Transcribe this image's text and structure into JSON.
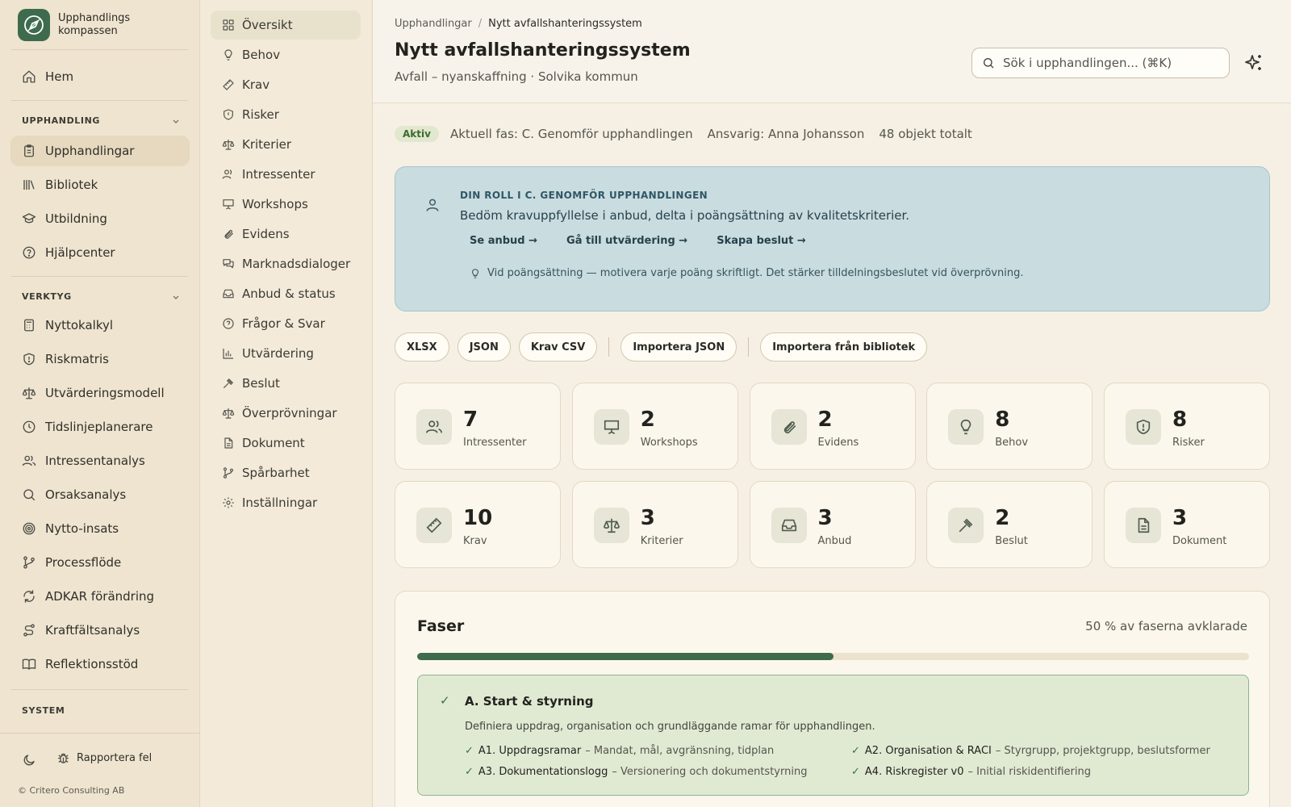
{
  "brand": {
    "name": "Upphandlings kompassen"
  },
  "sidebar": {
    "home": "Hem",
    "sections": {
      "procurement": "UPPHANDLING",
      "tools": "VERKTYG",
      "system": "SYSTEM"
    },
    "procurement_items": [
      "Upphandlingar",
      "Bibliotek",
      "Utbildning",
      "Hjälpcenter"
    ],
    "tool_items": [
      "Nyttokalkyl",
      "Riskmatris",
      "Utvärderingsmodell",
      "Tidslinjeplanerare",
      "Intressentanalys",
      "Orsaksanalys",
      "Nytto-insats",
      "Processflöde",
      "ADKAR förändring",
      "Kraftfältsanalys",
      "Reflektionsstöd"
    ],
    "report_bug": "Rapportera fel",
    "copyright": "© Critero Consulting AB"
  },
  "subnav": {
    "items": [
      "Översikt",
      "Behov",
      "Krav",
      "Risker",
      "Kriterier",
      "Intressenter",
      "Workshops",
      "Evidens",
      "Marknadsdialoger",
      "Anbud & status",
      "Frågor & Svar",
      "Utvärdering",
      "Beslut",
      "Överprövningar",
      "Dokument",
      "Spårbarhet",
      "Inställningar"
    ]
  },
  "header": {
    "breadcrumb_root": "Upphandlingar",
    "breadcrumb_current": "Nytt avfallshanteringssystem",
    "title": "Nytt avfallshanteringssystem",
    "subtitle": "Avfall – nyanskaffning · Solvika kommun",
    "search_placeholder": "Sök i upphandlingen... (⌘K)"
  },
  "status": {
    "badge": "Aktiv",
    "phase": "Aktuell fas: C. Genomför upphandlingen",
    "owner": "Ansvarig: Anna Johansson",
    "total": "48 objekt totalt"
  },
  "role": {
    "eyebrow": "DIN ROLL I C. GENOMFÖR UPPHANDLINGEN",
    "text": "Bedöm kravuppfyllelse i anbud, delta i poängsättning av kvalitetskriterier.",
    "links": [
      "Se anbud →",
      "Gå till utvärdering →",
      "Skapa beslut →"
    ],
    "tip": "Vid poängsättning — motivera varje poäng skriftligt. Det stärker tilldelningsbeslutet vid överprövning."
  },
  "actions": {
    "export": [
      "XLSX",
      "JSON",
      "Krav CSV"
    ],
    "import_json": "Importera JSON",
    "import_library": "Importera från bibliotek"
  },
  "stats": [
    {
      "value": "7",
      "label": "Intressenter",
      "icon": "users-icon"
    },
    {
      "value": "2",
      "label": "Workshops",
      "icon": "presentation-icon"
    },
    {
      "value": "2",
      "label": "Evidens",
      "icon": "paperclip-icon"
    },
    {
      "value": "8",
      "label": "Behov",
      "icon": "lightbulb-icon"
    },
    {
      "value": "8",
      "label": "Risker",
      "icon": "shield-alert-icon"
    },
    {
      "value": "10",
      "label": "Krav",
      "icon": "ruler-icon"
    },
    {
      "value": "3",
      "label": "Kriterier",
      "icon": "scale-icon"
    },
    {
      "value": "3",
      "label": "Anbud",
      "icon": "inbox-icon"
    },
    {
      "value": "2",
      "label": "Beslut",
      "icon": "gavel-icon"
    },
    {
      "value": "3",
      "label": "Dokument",
      "icon": "document-icon"
    }
  ],
  "phases": {
    "title": "Faser",
    "progress_label": "50 % av faserna avklarade",
    "progress_fraction": 0.5,
    "phase_a": {
      "check": "✓",
      "title": "A. Start & styrning",
      "description": "Definiera uppdrag, organisation och grundläggande ramar för upphandlingen.",
      "steps": [
        {
          "code": "A1. Uppdragsramar",
          "desc": "– Mandat, mål, avgränsning, tidplan"
        },
        {
          "code": "A2. Organisation & RACI",
          "desc": "– Styrgrupp, projektgrupp, beslutsformer"
        },
        {
          "code": "A3. Dokumentationslogg",
          "desc": "– Versionering och dokumentstyrning"
        },
        {
          "code": "A4. Riskregister v0",
          "desc": "– Initial riskidentifiering"
        }
      ]
    }
  },
  "colors": {
    "accent": "#3d6b4c",
    "sidebar_bg": "#efe4cf",
    "role_card_bg": "#c9dcdf"
  }
}
